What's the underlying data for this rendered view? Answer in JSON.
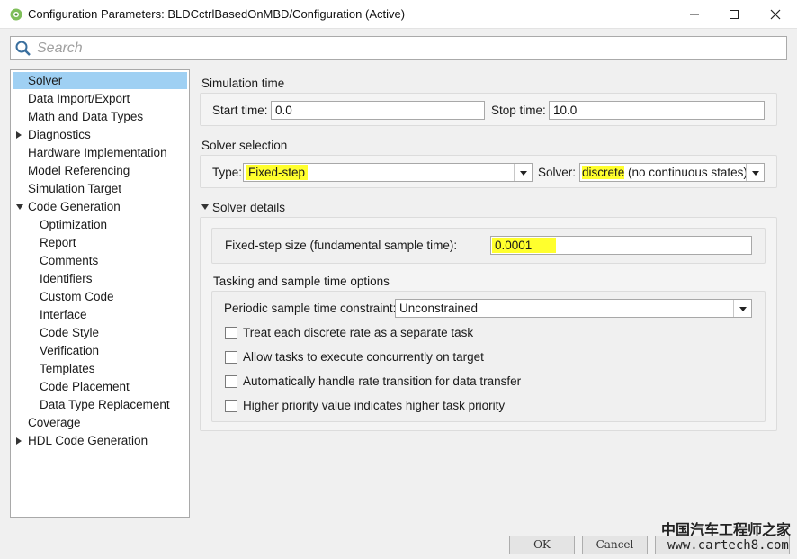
{
  "window": {
    "title": "Configuration Parameters: BLDCctrlBasedOnMBD/Configuration (Active)",
    "icons": {
      "app": "matlab-gear-icon",
      "minimize": "minimize-icon",
      "maximize": "maximize-icon",
      "close": "close-icon"
    }
  },
  "search": {
    "placeholder": "Search",
    "value": "",
    "icon": "search-icon"
  },
  "nav": {
    "items": [
      {
        "label": "Solver",
        "selected": true
      },
      {
        "label": "Data Import/Export"
      },
      {
        "label": "Math and Data Types"
      },
      {
        "label": "Diagnostics",
        "expander": "collapsed"
      },
      {
        "label": "Hardware Implementation"
      },
      {
        "label": "Model Referencing"
      },
      {
        "label": "Simulation Target"
      },
      {
        "label": "Code Generation",
        "expander": "expanded"
      },
      {
        "label": "Optimization"
      },
      {
        "label": "Report"
      },
      {
        "label": "Comments"
      },
      {
        "label": "Identifiers"
      },
      {
        "label": "Custom Code"
      },
      {
        "label": "Interface"
      },
      {
        "label": "Code Style"
      },
      {
        "label": "Verification"
      },
      {
        "label": "Templates"
      },
      {
        "label": "Code Placement"
      },
      {
        "label": "Data Type Replacement"
      },
      {
        "label": "Coverage"
      },
      {
        "label": "HDL Code Generation",
        "expander": "collapsed"
      }
    ]
  },
  "simulation_time": {
    "title": "Simulation time",
    "start_label": "Start time:",
    "start_value": "0.0",
    "stop_label": "Stop time:",
    "stop_value": "10.0"
  },
  "solver_selection": {
    "title": "Solver selection",
    "type_label": "Type:",
    "type_value": "Fixed-step",
    "solver_label": "Solver:",
    "solver_value_main": "discrete",
    "solver_value_rest": " (no continuous states)"
  },
  "solver_details": {
    "title": "Solver details",
    "step_label": "Fixed-step size (fundamental sample time):",
    "step_value": "0.0001"
  },
  "tasking": {
    "title": "Tasking and sample time options",
    "constraint_label": "Periodic sample time constraint:",
    "constraint_value": "Unconstrained",
    "checkboxes": [
      {
        "label": "Treat each discrete rate as a separate task",
        "checked": false
      },
      {
        "label": "Allow tasks to execute concurrently on target",
        "checked": false
      },
      {
        "label": "Automatically handle rate transition for data transfer",
        "checked": false
      },
      {
        "label": "Higher priority value indicates higher task priority",
        "checked": false
      }
    ]
  },
  "buttons": {
    "ok": "OK",
    "cancel": "Cancel"
  },
  "watermark": {
    "brand": "中国汽车工程师之家",
    "url": "www.cartech8.com"
  },
  "colors": {
    "highlight": "#ffff2d",
    "selected": "#9fd0f3"
  }
}
